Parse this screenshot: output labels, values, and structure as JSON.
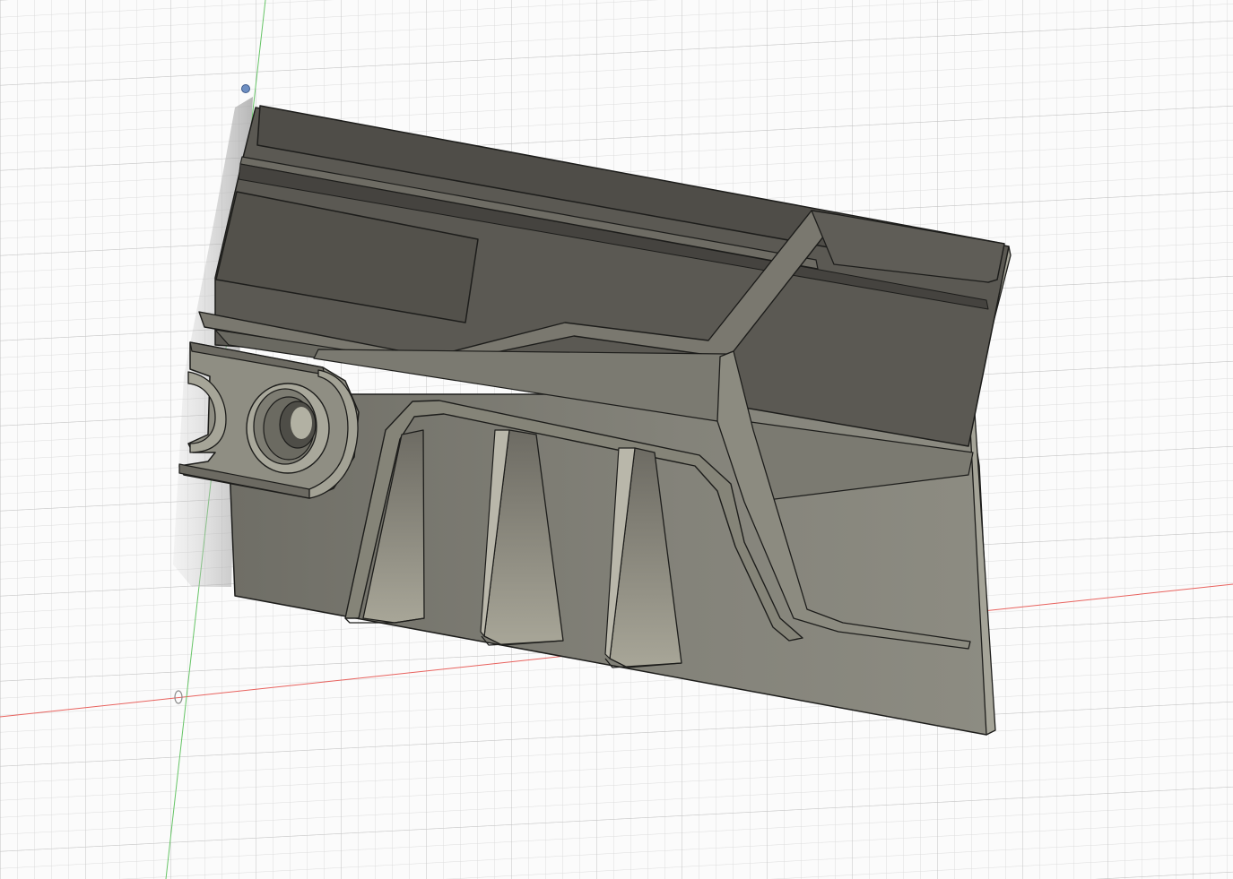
{
  "app": {
    "view": "3d-viewport",
    "background_color": "#fbfbfb",
    "grid_minor_color": "#dcdcdc",
    "grid_major_color": "#c3c3c3"
  },
  "axes": {
    "x_axis_color": "#e8625e",
    "y_axis_color": "#66c466"
  },
  "model": {
    "body_color": "#7d7c72",
    "face_dark_color": "#5a5852",
    "face_mid_color": "#6f6d65",
    "face_light_color": "#9a998e",
    "edge_color": "#1d1d1b"
  },
  "icons": {
    "origin": "origin-icon",
    "pivot": "pivot-point-icon"
  }
}
